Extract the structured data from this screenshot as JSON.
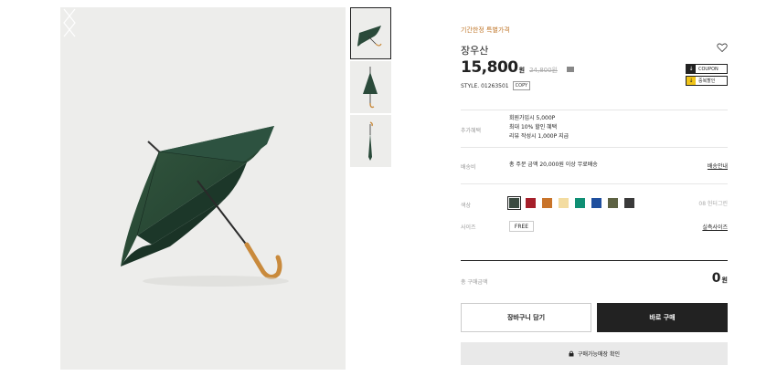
{
  "product": {
    "promo_label": "기간한정 특별가격",
    "name": "장우산",
    "price": "15,800",
    "price_unit": "원",
    "original_price": "24,800원",
    "style_label": "STYLE. 01263501",
    "copy_label": "COPY"
  },
  "coupons": [
    {
      "label": "COUPON"
    },
    {
      "label": "중복할인"
    }
  ],
  "benefits": {
    "label": "추가혜택",
    "lines": [
      "회원가입시 5,000P",
      "최대 10% 할인 혜택",
      "리뷰 작성시 1,000P 지급"
    ]
  },
  "shipping": {
    "label": "배송비",
    "text": "총 주문 금액 20,000원 이상 무료배송",
    "link": "배송안내"
  },
  "color": {
    "label": "색상",
    "selected_name": "08 헌터그린",
    "swatches": [
      "#3a4a40",
      "#a51f2a",
      "#c9742a",
      "#f3dca0",
      "#0f8f74",
      "#1f4f9e",
      "#5d6243",
      "#3a3a3a"
    ]
  },
  "size": {
    "label": "사이즈",
    "option": "FREE",
    "link": "실측사이즈"
  },
  "total": {
    "label": "총 구매금액",
    "value": "0",
    "unit": "원"
  },
  "buttons": {
    "cart": "장바구니 담기",
    "buy": "바로 구매",
    "store": "구매가능매장 확인"
  },
  "colors": {
    "promo": "#c0772b",
    "umbrella": "#2a4a3a",
    "handle": "#c98a3c"
  }
}
